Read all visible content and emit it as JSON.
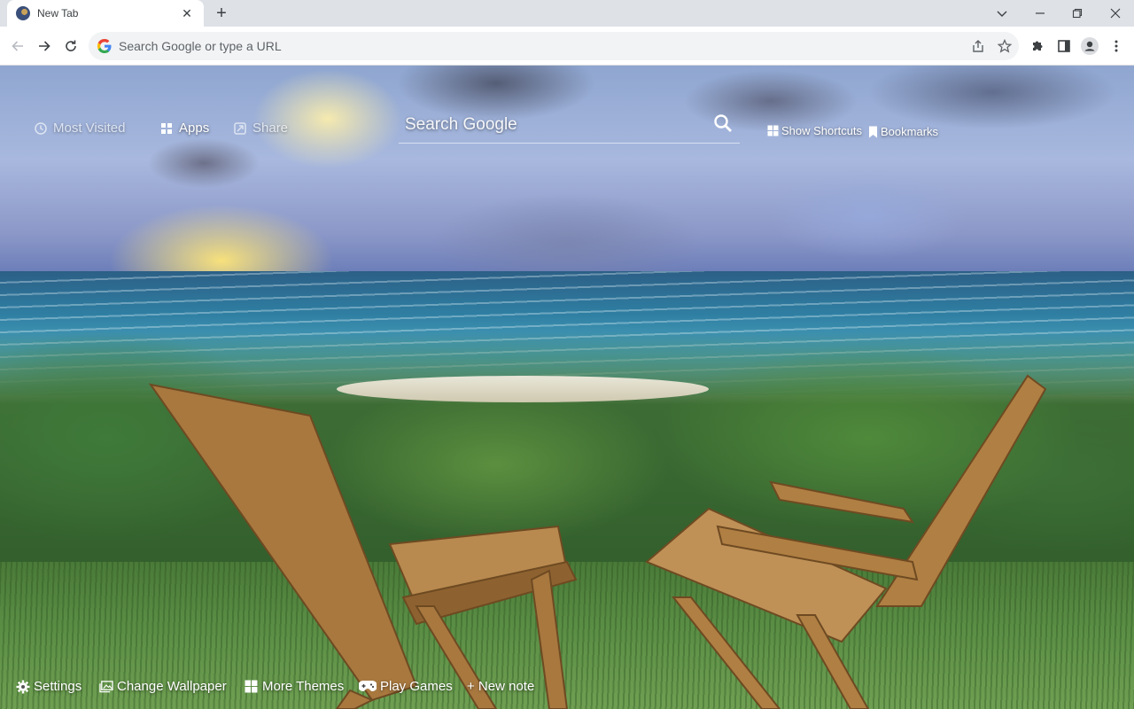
{
  "tab": {
    "title": "New Tab",
    "close": "✕"
  },
  "newtab": "+",
  "omnibox": {
    "placeholder": "Search Google or type a URL"
  },
  "topbar": {
    "most_visited": "Most Visited",
    "apps": "Apps",
    "share": "Share"
  },
  "search": {
    "placeholder": "Search Google"
  },
  "right_links": {
    "show_shortcuts": "Show Shortcuts",
    "bookmarks": "Bookmarks"
  },
  "bottombar": {
    "settings": "Settings",
    "change_wallpaper": "Change Wallpaper",
    "more_themes": "More Themes",
    "play_games": "Play Games",
    "new_note": "+ New note"
  },
  "icons": {
    "back": "back-arrow-icon",
    "forward": "forward-arrow-icon",
    "reload": "reload-icon",
    "share": "share-icon",
    "star": "star-icon",
    "extensions": "puzzle-icon",
    "sidepanel": "side-panel-icon",
    "profile": "profile-icon",
    "menu": "kebab-menu-icon"
  },
  "colors": {
    "toolbar_bg": "#ffffff",
    "tabstrip_bg": "#dee1e6",
    "omnibox_bg": "#f1f3f4"
  }
}
